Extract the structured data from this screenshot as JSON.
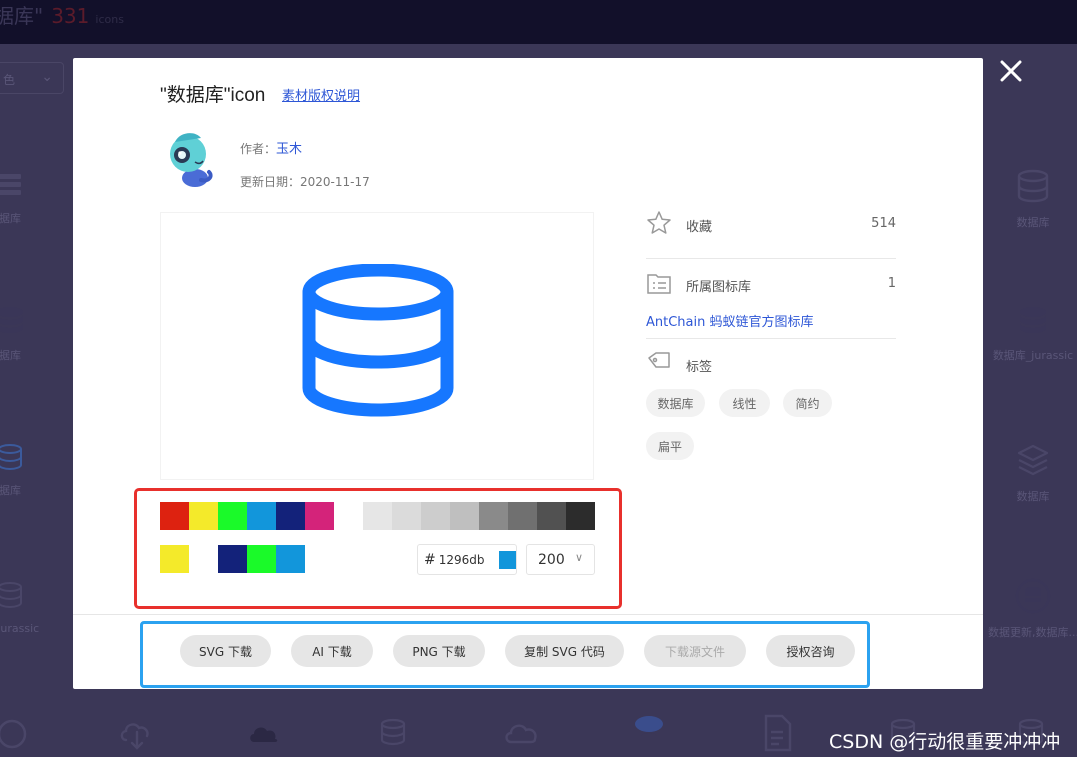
{
  "background": {
    "title": "据库\"",
    "count": "331",
    "unit": "icons",
    "select_value": "色",
    "left_cards": [
      "据库",
      "据库",
      "据库",
      "库_jurassic"
    ],
    "right_cards": [
      "数据库",
      "数据库_jurassic",
      "数据库",
      "数据更新,数据库..."
    ]
  },
  "modal": {
    "title": "\"数据库\"icon",
    "license_link": "素材版权说明",
    "author_label": "作者：",
    "author_name": "玉木",
    "date_label": "更新日期：",
    "date_value": "2020-11-17",
    "palette_row1": [
      "#dd2210",
      "#f4ea2a",
      "#1afa29",
      "#1296db",
      "#13227a",
      "#d4237a",
      "#ffffff",
      "#e6e6e6",
      "#dbdbdb",
      "#cdcdcd",
      "#bfbfbf",
      "#8a8a8a",
      "#707070",
      "#515151",
      "#2c2c2c"
    ],
    "palette_row2": [
      "#f4ea2a",
      "#ffffff",
      "#13227a",
      "#1afa29",
      "#1296db"
    ],
    "hex_hash": "#",
    "hex_value": "1296db",
    "size_value": "200",
    "buttons": [
      {
        "label": "SVG 下载",
        "disabled": false
      },
      {
        "label": "AI 下载",
        "disabled": false
      },
      {
        "label": "PNG 下载",
        "disabled": false
      },
      {
        "label": "复制 SVG 代码",
        "disabled": false
      },
      {
        "label": "下载源文件",
        "disabled": true
      },
      {
        "label": "授权咨询",
        "disabled": false
      }
    ],
    "side": {
      "favorite_label": "收藏",
      "favorite_count": "514",
      "library_label": "所属图标库",
      "library_count": "1",
      "library_name": "AntChain 蚂蚁链官方图标库",
      "tags_label": "标签",
      "tags": [
        "数据库",
        "线性",
        "简约",
        "扁平"
      ]
    }
  },
  "watermark": "CSDN @行动很重要冲冲冲"
}
